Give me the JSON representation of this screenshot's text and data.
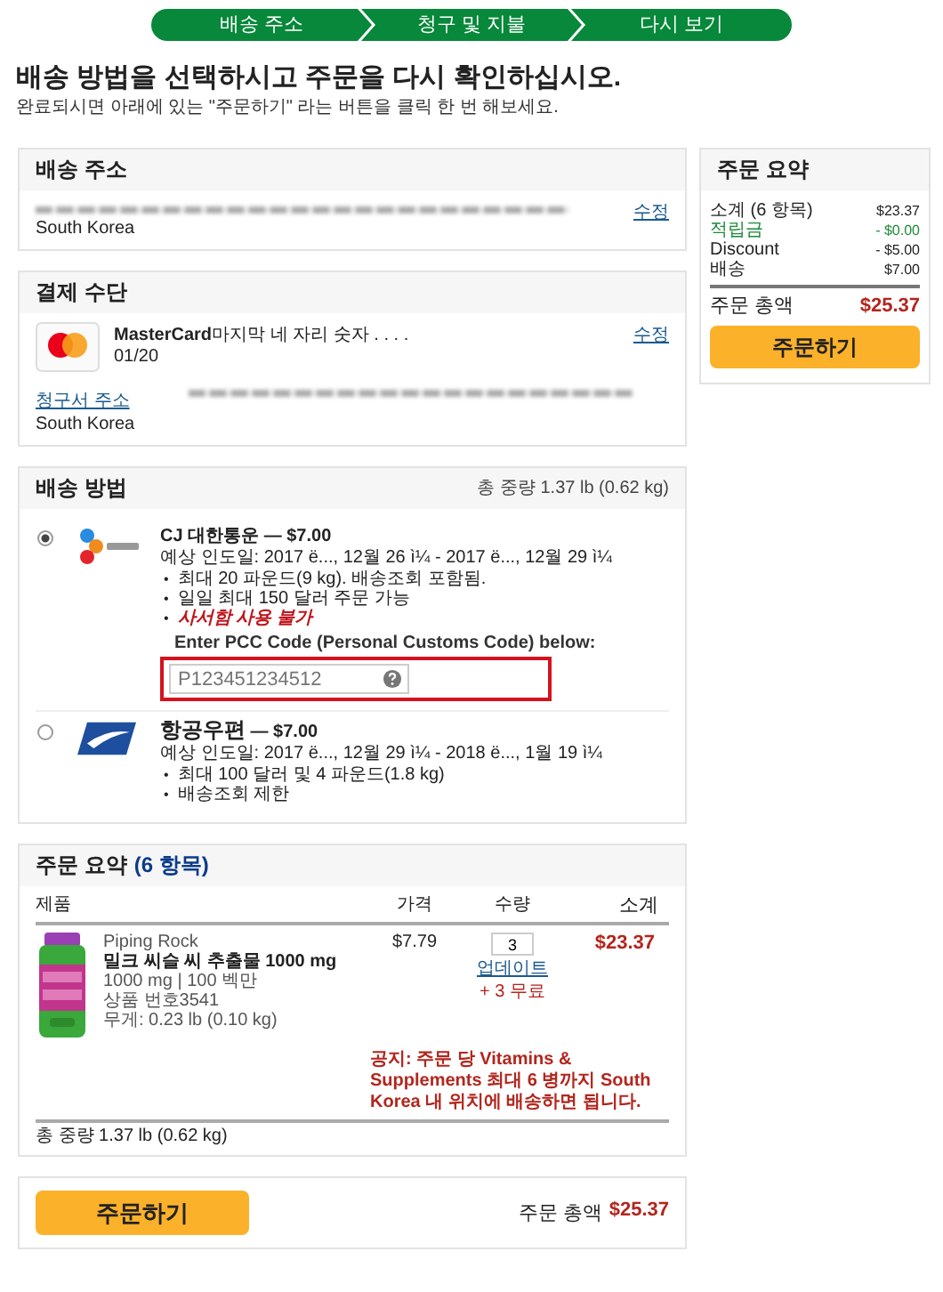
{
  "steps": [
    "배송 주소",
    "청구 및 지불",
    "다시 보기"
  ],
  "heading": "배송 방법을 선택하시고 주문을 다시 확인하십시오.",
  "subheading": "완료되시면 아래에 있는 \"주문하기\" 라는 버튼을 클릭 한 번 해보세요.",
  "shipping_address": {
    "title": "배송 주소",
    "edit": "수정",
    "country": "South Korea"
  },
  "payment": {
    "title": "결제 수단",
    "card_text": "**MasterCard**마지막 네 자리 숫자 . . . .",
    "expiry": "01/20",
    "edit": "수정",
    "billing_label": "청구서 주소",
    "billing_country": "South Korea"
  },
  "shipping_method": {
    "title": "배송 방법",
    "total_weight": "총 중량 1.37 lb (0.62 kg)",
    "options": [
      {
        "selected": true,
        "kind": "cj",
        "carrier": "CJ 대한통운",
        "price": "— $7.00",
        "eta": "예상 인도일: 2017 ë..., 12월 26 ì¼ - 2017 ë..., 12월 29 ì¼",
        "notes": [
          {
            "kind": "normal",
            "bullet": "•",
            "text": "최대 20 파운드(9 kg). 배송조회 포함됨."
          },
          {
            "kind": "normal",
            "bullet": "•",
            "text": "일일 최대 150 달러 주문 가능"
          },
          {
            "kind": "warning",
            "bullet": "•",
            "text": "사서함 사용 불가"
          }
        ],
        "pcc": {
          "label": "Enter PCC Code (Personal Customs Code) below:",
          "placeholder": "P123451234512"
        }
      },
      {
        "selected": false,
        "kind": "post",
        "carrier": "항공우편",
        "price": "— $7.00",
        "eta": "예상 인도일: 2017 ë..., 12월 29 ì¼ - 2018 ë..., 1월 19 ì¼",
        "notes": [
          {
            "kind": "normal",
            "bullet": "•",
            "text": "최대 100 달러 및 4 파운드(1.8 kg)"
          },
          {
            "kind": "normal",
            "bullet": "•",
            "text": "배송조회 제한"
          }
        ]
      }
    ]
  },
  "order": {
    "title": "주문 요약",
    "count": "(6 항목)",
    "columns": [
      "제품",
      "가격",
      "수량",
      "소계"
    ],
    "item": {
      "brand": "Piping Rock",
      "name": "밀크 씨슬 씨 추출물 1000 mg",
      "details": [
        "1000 mg | 100 벡만",
        "상품 번호3541",
        "무게: 0.23 lb (0.10 kg)"
      ],
      "price": "$7.79",
      "quantity": "3",
      "update": "업데이트",
      "free": "+ 3 무료",
      "subtotal": "$23.37",
      "notice": "공지: 주문 당 Vitamins & Supplements 최대 6 병까지 South Korea 내 위치에 배송하면 됩니다."
    },
    "total_weight": "총 중량 1.37 lb (0.62 kg)"
  },
  "bottom": {
    "button": "주문하기",
    "total_label": "주문 총액",
    "total": "$25.37"
  },
  "summary": {
    "title": "주문 요약",
    "lines": [
      {
        "kind": "normal",
        "label": "소계 (6 항목)",
        "value": "$23.37"
      },
      {
        "kind": "credit",
        "label": "적립금",
        "value": "- $0.00"
      },
      {
        "kind": "normal",
        "label": "Discount",
        "value": "- $5.00"
      },
      {
        "kind": "normal",
        "label": "배송",
        "value": "$7.00"
      }
    ],
    "total_label": "주문 총액",
    "total": "$25.37",
    "button": "주문하기"
  }
}
